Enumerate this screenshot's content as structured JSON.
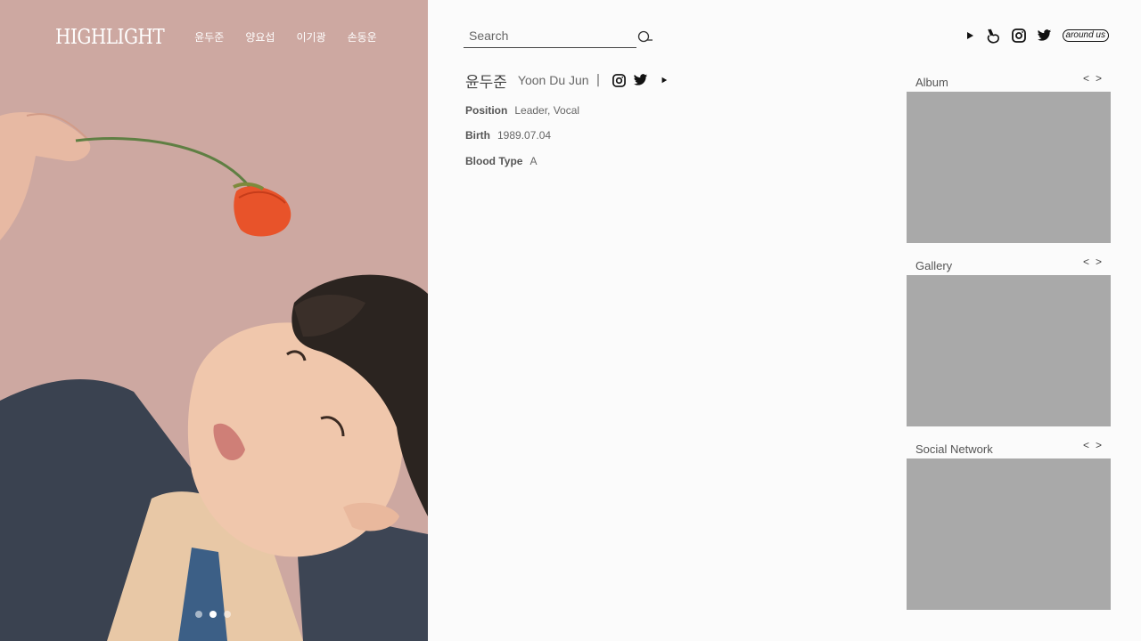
{
  "brand": {
    "logo": "HIGHLIGHT"
  },
  "nav": {
    "items": [
      "윤두준",
      "양요섭",
      "이기광",
      "손동운"
    ]
  },
  "search": {
    "placeholder": "Search"
  },
  "top_social": [
    "youtube-icon",
    "vlive-icon",
    "instagram-icon",
    "twitter-icon",
    "around-us-logo"
  ],
  "around_us": "around us",
  "profile": {
    "name_ko": "윤두준",
    "name_en": "Yoon Du Jun",
    "separator": "|",
    "position_label": "Position",
    "position_value": "Leader, Vocal",
    "birth_label": "Birth",
    "birth_value": "1989.07.04",
    "blood_label": "Blood Type",
    "blood_value": "A"
  },
  "widgets": [
    {
      "title": "Album",
      "prev": "<",
      "next": ">"
    },
    {
      "title": "Gallery",
      "prev": "<",
      "next": ">"
    },
    {
      "title": "Social Network",
      "prev": "<",
      "next": ">"
    }
  ],
  "carousel": {
    "count": 3,
    "active_index": 1
  },
  "colors": {
    "placeholder_box": "#a9a9a9",
    "background": "#fbfbfb",
    "hero_bg": "#cfa9a3"
  }
}
